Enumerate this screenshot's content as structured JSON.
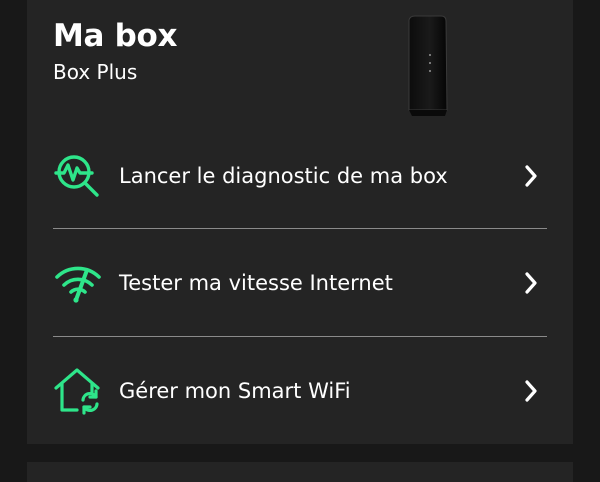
{
  "card": {
    "title": "Ma box",
    "subtitle": "Box Plus",
    "device_image": "box-device-icon"
  },
  "menu": [
    {
      "label": "Lancer le diagnostic de ma box",
      "icon": "diagnostic-magnifier-icon"
    },
    {
      "label": "Tester ma vitesse Internet",
      "icon": "wifi-speed-icon"
    },
    {
      "label": "Gérer mon Smart WiFi",
      "icon": "home-sync-icon"
    }
  ],
  "colors": {
    "accent": "#2ee58a",
    "card": "#242424",
    "background": "#181818",
    "divider": "#8a8a8a"
  }
}
